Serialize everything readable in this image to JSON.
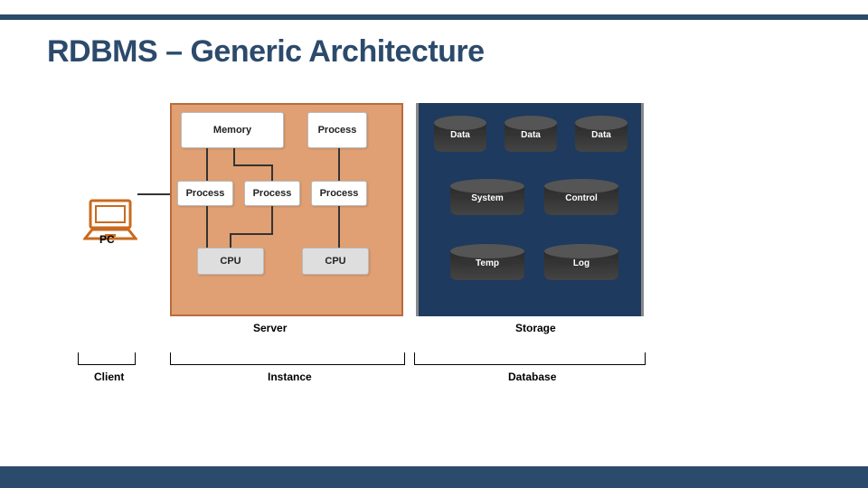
{
  "title": "RDBMS – Generic Architecture",
  "client": {
    "pc_label": "PC",
    "group_label": "Client"
  },
  "server": {
    "memory": "Memory",
    "process_top": "Process",
    "process1": "Process",
    "process2": "Process",
    "process3": "Process",
    "cpu1": "CPU",
    "cpu2": "CPU",
    "label": "Server",
    "group_label": "Instance"
  },
  "storage": {
    "data1": "Data",
    "data2": "Data",
    "data3": "Data",
    "system": "System",
    "control": "Control",
    "temp": "Temp",
    "log": "Log",
    "label": "Storage",
    "group_label": "Database"
  }
}
